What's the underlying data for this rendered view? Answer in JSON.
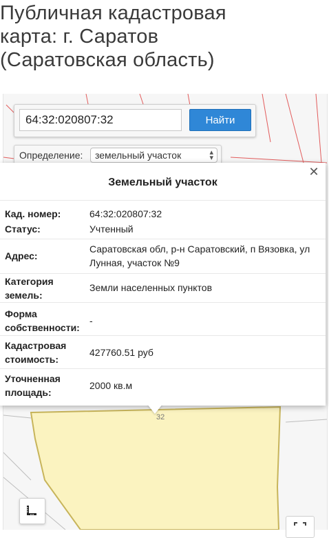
{
  "page": {
    "title": "Публичная кадастровая\nкарта: г. Саратов\n(Саратовская область)"
  },
  "search": {
    "value": "64:32:020807:32",
    "button_label": "Найти"
  },
  "definition": {
    "label": "Определение:",
    "selected": "земельный участок"
  },
  "popup": {
    "title": "Земельный участок",
    "rows": [
      {
        "label": "Кад. номер:",
        "value": "64:32:020807:32"
      },
      {
        "label": "Статус:",
        "value": "Учтенный"
      },
      {
        "label": "Адрес:",
        "value": "Саратовская обл, р-н Саратовский, п Вязовка, ул Лунная, участок №9"
      },
      {
        "label": "Категория земель:",
        "value": "Земли населенных пунктов"
      },
      {
        "label": "Форма собственности:",
        "value": "-"
      },
      {
        "label": "Кадастровая стоимость:",
        "value": "427760.51 руб"
      },
      {
        "label": "Уточненная площадь:",
        "value": "2000 кв.м"
      }
    ]
  },
  "map": {
    "parcel_label": "32",
    "parcel_fill": "#fbf3c0",
    "parcel_border": "#c7b45a",
    "line_color": "#e25b5b"
  },
  "icons": {
    "close": "close-icon",
    "ruler": "ruler-icon",
    "fullscreen": "fullscreen-icon",
    "chevron": "chevron-updown-icon"
  }
}
